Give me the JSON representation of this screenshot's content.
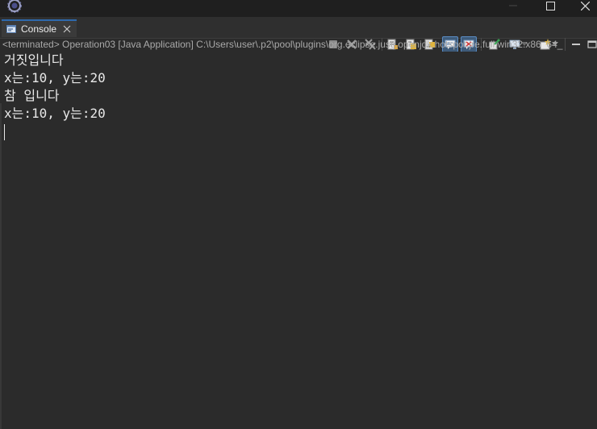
{
  "window": {
    "app_icon": "eclipse-icon",
    "controls": [
      "minimize-icon",
      "maximize-icon",
      "close-icon"
    ]
  },
  "console_tab": {
    "label": "Console",
    "icon": "console-icon"
  },
  "toolbar": {
    "buttons": [
      {
        "name": "terminate-button",
        "icon": "stop-square-icon"
      },
      {
        "name": "remove-launch-button",
        "icon": "x-icon"
      },
      {
        "name": "remove-all-terminated-button",
        "icon": "double-x-icon"
      },
      {
        "name": "clear-console-button",
        "icon": "clear-console-icon"
      },
      {
        "name": "scroll-lock-button",
        "icon": "scroll-lock-icon"
      },
      {
        "name": "word-wrap-button",
        "icon": "word-wrap-icon"
      },
      {
        "name": "show-console-on-stdout-button",
        "icon": "stdout-icon"
      },
      {
        "name": "show-console-on-stderr-button",
        "icon": "stderr-icon"
      },
      {
        "name": "pin-console-button",
        "icon": "pin-icon"
      },
      {
        "name": "display-selected-console-button",
        "icon": "monitor-icon"
      },
      {
        "name": "open-console-button",
        "icon": "new-console-icon"
      },
      {
        "name": "minimize-view-button",
        "icon": "minimize-view-icon"
      },
      {
        "name": "maximize-view-button",
        "icon": "maximize-view-icon"
      }
    ]
  },
  "process_line": "<terminated> Operation03 [Java Application] C:\\Users\\user\\.p2\\pool\\plugins\\org.eclipse.justj.openjdk.hotspot.jre.full.win32.x86_64_",
  "output_lines": [
    "거짓입니다",
    "x는:10, y는:20",
    "참 입니다",
    "x는:10, y는:20"
  ],
  "colors": {
    "background": "#2b2b2b",
    "text": "#e8e8e8",
    "process_text": "#a9a9a9",
    "tab_accent": "#2d69ad"
  }
}
